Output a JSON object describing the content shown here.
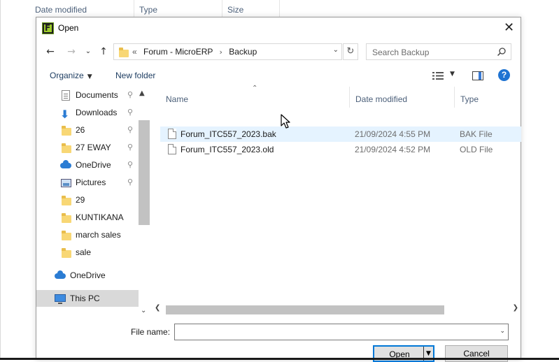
{
  "background": {
    "columns": [
      "Date modified",
      "Type",
      "Size"
    ]
  },
  "dialog": {
    "title": "Open",
    "close_glyph": "✕"
  },
  "nav": {
    "back_glyph": "←",
    "forward_glyph": "→",
    "recent_glyph": "⌄",
    "up_glyph": "↑",
    "breadcrumb_prefix": "«",
    "breadcrumbs": [
      "Forum - MicroERP",
      "Backup"
    ],
    "separator_glyph": "›",
    "refresh_glyph": "↻",
    "search_placeholder": "Search Backup"
  },
  "toolbar": {
    "organize": "Organize",
    "new_folder": "New folder",
    "help": "?"
  },
  "sidebar": {
    "items": [
      {
        "label": "Documents",
        "icon": "documents-icon",
        "pinned": true
      },
      {
        "label": "Downloads",
        "icon": "downloads-icon",
        "pinned": true
      },
      {
        "label": "26",
        "icon": "folder-icon",
        "pinned": true
      },
      {
        "label": "27 EWAY",
        "icon": "folder-icon",
        "pinned": true
      },
      {
        "label": "OneDrive",
        "icon": "onedrive-icon",
        "pinned": true
      },
      {
        "label": "Pictures",
        "icon": "pictures-icon",
        "pinned": true
      },
      {
        "label": "29",
        "icon": "folder-icon",
        "pinned": false
      },
      {
        "label": "KUNTIKANA",
        "icon": "folder-icon",
        "pinned": false
      },
      {
        "label": "march sales",
        "icon": "folder-icon",
        "pinned": false
      },
      {
        "label": "sale",
        "icon": "folder-icon",
        "pinned": false
      }
    ],
    "onedrive": "OneDrive",
    "this_pc": "This PC",
    "pin_glyph": "📌"
  },
  "filelist": {
    "columns": [
      "Name",
      "Date modified",
      "Type"
    ],
    "rows": [
      {
        "name": "Forum_ITC557_2023.bak",
        "date": "21/09/2024 4:55 PM",
        "type": "BAK File"
      },
      {
        "name": "Forum_ITC557_2023.old",
        "date": "21/09/2024 4:52 PM",
        "type": "OLD File"
      }
    ]
  },
  "footer": {
    "file_name_label": "File name:",
    "file_name_value": "",
    "open": "Open",
    "cancel": "Cancel"
  },
  "colors": {
    "accent": "#0078d7",
    "hover_row": "#e5f3ff",
    "selected": "#d9d9d9",
    "folder": "#f8d775",
    "help": "#1e73d2"
  }
}
